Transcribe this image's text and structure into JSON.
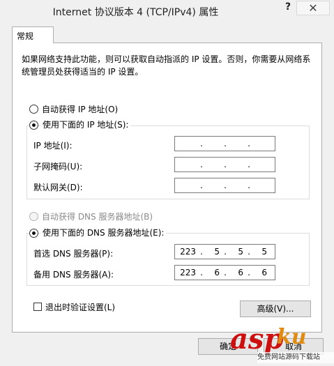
{
  "window": {
    "title": "Internet 协议版本 4 (TCP/IPv4) 属性",
    "help_glyph": "?",
    "close_glyph": "✕"
  },
  "tab": {
    "label": "常规"
  },
  "description": "如果网络支持此功能，则可以获取自动指派的 IP 设置。否则，你需要从网络系统管理员处获得适当的 IP 设置。",
  "ip": {
    "auto_label": "自动获得 IP 地址(O)",
    "auto_selected": false,
    "manual_label": "使用下面的 IP 地址(S):",
    "manual_selected": true,
    "fields": [
      {
        "label": "IP 地址(I):",
        "octets": [
          "",
          "",
          "",
          ""
        ]
      },
      {
        "label": "子网掩码(U):",
        "octets": [
          "",
          "",
          "",
          ""
        ]
      },
      {
        "label": "默认网关(D):",
        "octets": [
          "",
          "",
          "",
          ""
        ]
      }
    ]
  },
  "dns": {
    "auto_label": "自动获得 DNS 服务器地址(B)",
    "auto_selected": false,
    "auto_disabled": true,
    "manual_label": "使用下面的 DNS 服务器地址(E):",
    "manual_selected": true,
    "fields": [
      {
        "label": "首选 DNS 服务器(P):",
        "octets": [
          "223",
          "5",
          "5",
          "5"
        ]
      },
      {
        "label": "备用 DNS 服务器(A):",
        "octets": [
          "223",
          "6",
          "6",
          "6"
        ]
      }
    ]
  },
  "validate": {
    "label": "退出时验证设置(L)",
    "checked": false
  },
  "advanced_label": "高级(V)...",
  "footer": {
    "ok_label": "确定",
    "cancel_label": "取消"
  },
  "watermark": {
    "brand": "asp",
    "brand_suffix": "ku",
    "tagline": "免费网站源码下载站",
    "colors": {
      "brand": "#cc1010",
      "suffix": "#e08a10"
    }
  }
}
